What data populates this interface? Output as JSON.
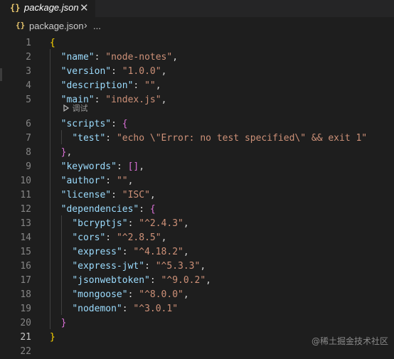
{
  "tab": {
    "icon": "{}",
    "filename": "package.json",
    "close": "✕"
  },
  "breadcrumb": {
    "icon": "{}",
    "file": "package.json",
    "chevron": "›",
    "more": "..."
  },
  "codelens": {
    "icon": "play-icon",
    "label": "调试"
  },
  "active_line": "21",
  "lines": [
    {
      "n": "1",
      "tokens": [
        [
          "b1",
          "{"
        ]
      ]
    },
    {
      "n": "2",
      "tokens": [
        [
          "k",
          "\"name\""
        ],
        [
          "p",
          ": "
        ],
        [
          "s",
          "\"node-notes\""
        ],
        [
          "p",
          ","
        ]
      ]
    },
    {
      "n": "3",
      "tokens": [
        [
          "k",
          "\"version\""
        ],
        [
          "p",
          ": "
        ],
        [
          "s",
          "\"1.0.0\""
        ],
        [
          "p",
          ","
        ]
      ]
    },
    {
      "n": "4",
      "tokens": [
        [
          "k",
          "\"description\""
        ],
        [
          "p",
          ": "
        ],
        [
          "s",
          "\"\""
        ],
        [
          "p",
          ","
        ]
      ]
    },
    {
      "n": "5",
      "tokens": [
        [
          "k",
          "\"main\""
        ],
        [
          "p",
          ": "
        ],
        [
          "s",
          "\"index.js\""
        ],
        [
          "p",
          ","
        ]
      ]
    },
    {
      "n": "6",
      "tokens": [
        [
          "k",
          "\"scripts\""
        ],
        [
          "p",
          ": "
        ],
        [
          "b2",
          "{"
        ]
      ]
    },
    {
      "n": "7",
      "tokens": [
        [
          "k",
          "\"test\""
        ],
        [
          "p",
          ": "
        ],
        [
          "s",
          "\"echo \\\"Error: no test specified\\\" && exit 1\""
        ]
      ]
    },
    {
      "n": "8",
      "tokens": [
        [
          "b2",
          "}"
        ],
        [
          "p",
          ","
        ]
      ]
    },
    {
      "n": "9",
      "tokens": [
        [
          "k",
          "\"keywords\""
        ],
        [
          "p",
          ": "
        ],
        [
          "b2",
          "[]"
        ],
        [
          "p",
          ","
        ]
      ]
    },
    {
      "n": "10",
      "tokens": [
        [
          "k",
          "\"author\""
        ],
        [
          "p",
          ": "
        ],
        [
          "s",
          "\"\""
        ],
        [
          "p",
          ","
        ]
      ]
    },
    {
      "n": "11",
      "tokens": [
        [
          "k",
          "\"license\""
        ],
        [
          "p",
          ": "
        ],
        [
          "s",
          "\"ISC\""
        ],
        [
          "p",
          ","
        ]
      ]
    },
    {
      "n": "12",
      "tokens": [
        [
          "k",
          "\"dependencies\""
        ],
        [
          "p",
          ": "
        ],
        [
          "b2",
          "{"
        ]
      ]
    },
    {
      "n": "13",
      "tokens": [
        [
          "k",
          "\"bcryptjs\""
        ],
        [
          "p",
          ": "
        ],
        [
          "s",
          "\"^2.4.3\""
        ],
        [
          "p",
          ","
        ]
      ]
    },
    {
      "n": "14",
      "tokens": [
        [
          "k",
          "\"cors\""
        ],
        [
          "p",
          ": "
        ],
        [
          "s",
          "\"^2.8.5\""
        ],
        [
          "p",
          ","
        ]
      ]
    },
    {
      "n": "15",
      "tokens": [
        [
          "k",
          "\"express\""
        ],
        [
          "p",
          ": "
        ],
        [
          "s",
          "\"^4.18.2\""
        ],
        [
          "p",
          ","
        ]
      ]
    },
    {
      "n": "16",
      "tokens": [
        [
          "k",
          "\"express-jwt\""
        ],
        [
          "p",
          ": "
        ],
        [
          "s",
          "\"^5.3.3\""
        ],
        [
          "p",
          ","
        ]
      ]
    },
    {
      "n": "17",
      "tokens": [
        [
          "k",
          "\"jsonwebtoken\""
        ],
        [
          "p",
          ": "
        ],
        [
          "s",
          "\"^9.0.2\""
        ],
        [
          "p",
          ","
        ]
      ]
    },
    {
      "n": "18",
      "tokens": [
        [
          "k",
          "\"mongoose\""
        ],
        [
          "p",
          ": "
        ],
        [
          "s",
          "\"^8.0.0\""
        ],
        [
          "p",
          ","
        ]
      ]
    },
    {
      "n": "19",
      "tokens": [
        [
          "k",
          "\"nodemon\""
        ],
        [
          "p",
          ": "
        ],
        [
          "s",
          "\"^3.0.1\""
        ]
      ]
    },
    {
      "n": "20",
      "tokens": [
        [
          "b2",
          "}"
        ]
      ]
    },
    {
      "n": "21",
      "tokens": [
        [
          "b1",
          "}"
        ]
      ]
    },
    {
      "n": "22",
      "tokens": []
    }
  ],
  "watermark": "@稀土掘金技术社区",
  "colors": {
    "background": "#1e1e1e",
    "key": "#9cdcfe",
    "string": "#ce9178",
    "bracket_outer": "#ffd700",
    "bracket_inner": "#da70d6"
  }
}
